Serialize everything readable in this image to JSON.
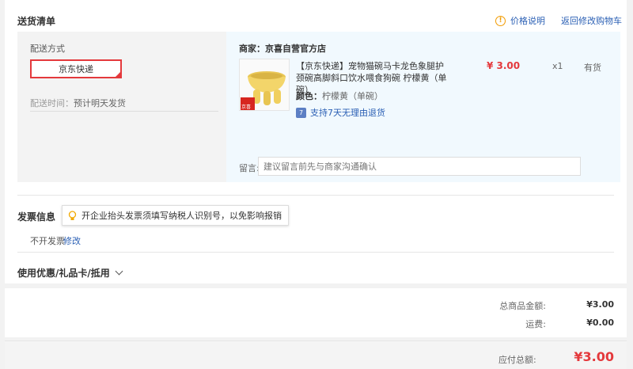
{
  "header": {
    "title": "送货清单",
    "price_note": "价格说明",
    "back_cart": "返回修改购物车"
  },
  "shipping": {
    "label": "配送方式",
    "method": "京东快递",
    "time_label": "配送时间：",
    "time_value": "预计明天发货"
  },
  "product": {
    "seller": "商家：京喜自营官方店",
    "badge": "京喜",
    "name": "【京东快递】宠物猫碗马卡龙色象腿护颈碗高脚斜口饮水喂食狗碗 柠檬黄（单碗）",
    "color_label": "颜色：",
    "color_value": "柠檬黄（单碗）",
    "return_policy": "支持7天无理由退货",
    "price": "¥ 3.00",
    "qty": "x1",
    "stock": "有货",
    "image_color": "#f3d56a"
  },
  "message": {
    "label": "留言:",
    "placeholder": "建议留言前先与商家沟通确认"
  },
  "invoice": {
    "title": "发票信息",
    "tip": "开企业抬头发票须填写纳税人识别号，以免影响报销",
    "value": "不开发票",
    "edit": "修改"
  },
  "coupon": {
    "title": "使用优惠/礼品卡/抵用"
  },
  "summary": {
    "goods_label": "总商品金额:",
    "goods_value": "¥3.00",
    "freight_label": "运费:",
    "freight_value": "¥0.00",
    "payable_label": "应付总额:",
    "payable_value": "¥3.00"
  },
  "colors": {
    "accent_red": "#e4393c",
    "link_blue": "#2a5fb4"
  }
}
